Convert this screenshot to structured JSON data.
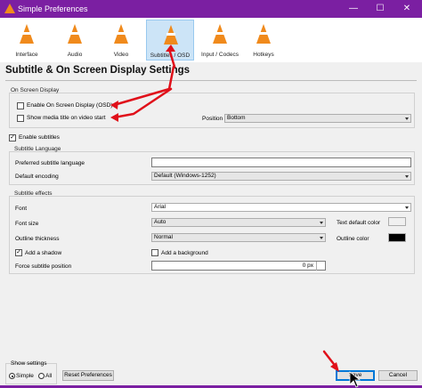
{
  "window": {
    "title": "Simple Preferences",
    "controls": [
      "—",
      "☐",
      "✕"
    ]
  },
  "toolbar": {
    "items": [
      {
        "label": "Interface"
      },
      {
        "label": "Audio"
      },
      {
        "label": "Video"
      },
      {
        "label": "Subtitles / OSD"
      },
      {
        "label": "Input / Codecs"
      },
      {
        "label": "Hotkeys"
      }
    ],
    "active_index": 3
  },
  "page": {
    "heading": "Subtitle & On Screen Display Settings"
  },
  "osd": {
    "section_title": "On Screen Display",
    "enable_osd_label": "Enable On Screen Display (OSD)",
    "enable_osd_checked": false,
    "show_title_label": "Show media title on video start",
    "show_title_checked": false,
    "position_label": "Position",
    "position_value": "Bottom"
  },
  "subtitles": {
    "enable_label": "Enable subtitles",
    "enable_checked": true,
    "language_section": "Subtitle Language",
    "preferred_language_label": "Preferred subtitle language",
    "preferred_language_value": "",
    "default_encoding_label": "Default encoding",
    "default_encoding_value": "Default (Windows-1252)"
  },
  "effects": {
    "section_title": "Subtitle effects",
    "font_label": "Font",
    "font_value": "Arial",
    "font_size_label": "Font size",
    "font_size_value": "Auto",
    "text_default_color_label": "Text default color",
    "text_default_color": "#f0f0f0",
    "outline_thickness_label": "Outline thickness",
    "outline_thickness_value": "Normal",
    "outline_color_label": "Outline color",
    "outline_color": "#000000",
    "add_shadow_label": "Add a shadow",
    "add_shadow_checked": true,
    "add_background_label": "Add a background",
    "add_background_checked": false,
    "force_position_label": "Force subtitle position",
    "force_position_value": "0 px"
  },
  "footer": {
    "show_settings_label": "Show settings",
    "simple_label": "Simple",
    "all_label": "All",
    "reset_label": "Reset Preferences",
    "save_label": "Save",
    "cancel_label": "Cancel"
  },
  "annotation_color": "#e0101a"
}
